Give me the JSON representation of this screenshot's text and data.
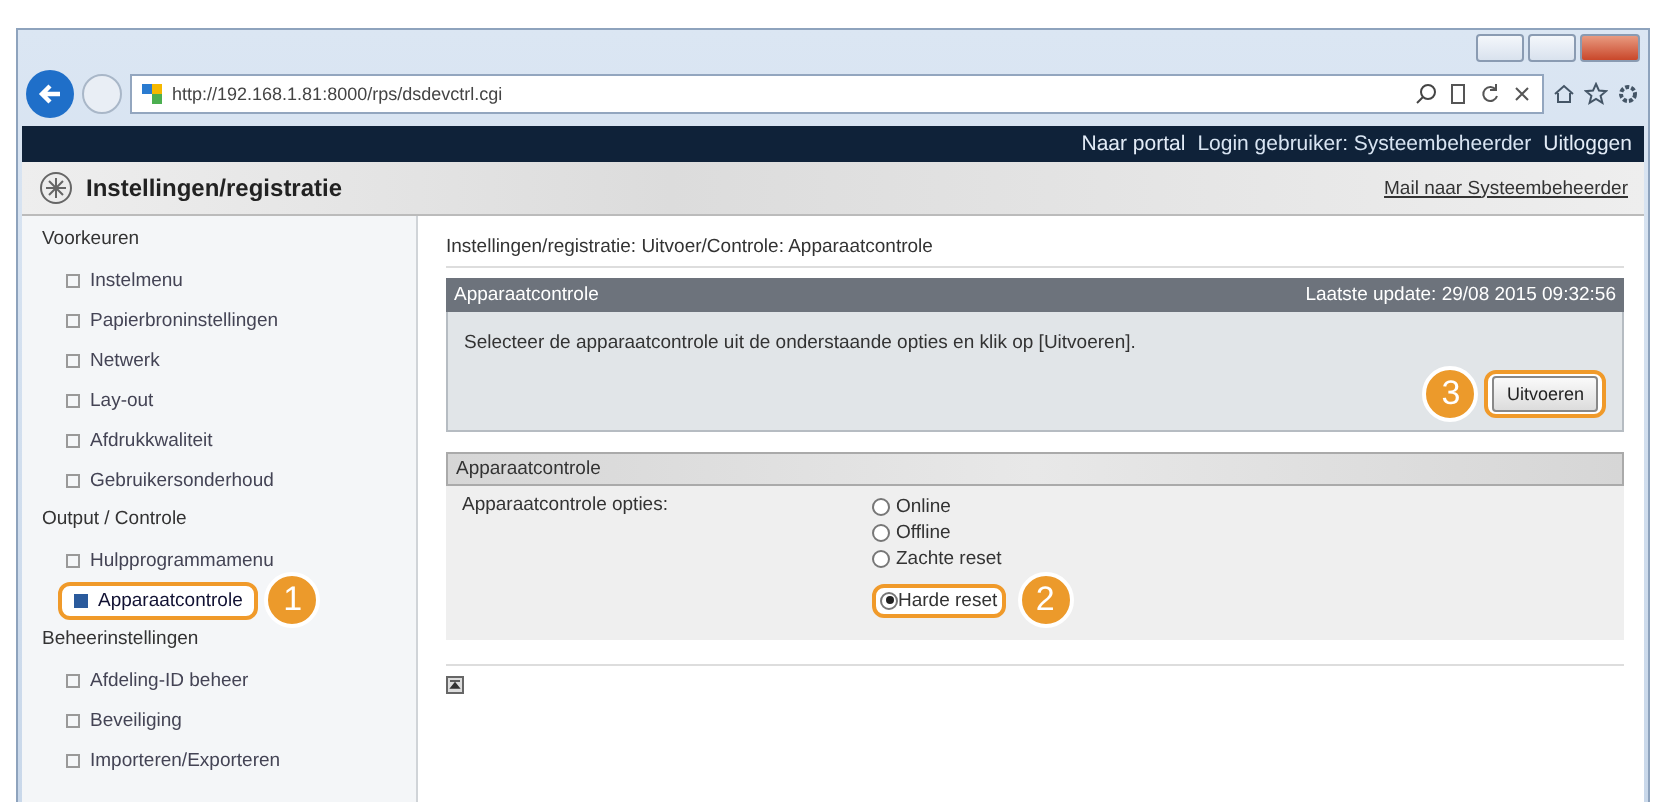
{
  "browser": {
    "url": "http://192.168.1.81:8000/rps/dsdevctrl.cgi"
  },
  "top_bar": [
    {
      "kind": "link",
      "text": "Naar portal"
    },
    {
      "kind": "text",
      "text": "Login gebruiker: Systeembeheerder"
    },
    {
      "kind": "link",
      "text": "Uitloggen"
    }
  ],
  "header": {
    "title": "Instellingen/registratie",
    "mail_link": "Mail naar Systeembeheerder"
  },
  "sidebar": [
    {
      "title": "Voorkeuren",
      "items": [
        {
          "label": "Instelmenu",
          "selected": false
        },
        {
          "label": "Papierbroninstellingen",
          "selected": false
        },
        {
          "label": "Netwerk",
          "selected": false
        },
        {
          "label": "Lay-out",
          "selected": false
        },
        {
          "label": "Afdrukkwaliteit",
          "selected": false
        },
        {
          "label": "Gebruikersonderhoud",
          "selected": false
        }
      ]
    },
    {
      "title": "Output / Controle",
      "items": [
        {
          "label": "Hulpprogrammamenu",
          "selected": false
        },
        {
          "label": "Apparaatcontrole",
          "selected": true,
          "callout": "1"
        }
      ]
    },
    {
      "title": "Beheerinstellingen",
      "items": [
        {
          "label": "Afdeling-ID beheer",
          "selected": false
        },
        {
          "label": "Beveiliging",
          "selected": false
        },
        {
          "label": "Importeren/Exporteren",
          "selected": false
        }
      ]
    }
  ],
  "breadcrumb": "Instellingen/registratie: Uitvoer/Controle: Apparaatcontrole",
  "panel": {
    "title": "Apparaatcontrole",
    "last_update": "Laatste update: 29/08 2015 09:32:56",
    "instruction": "Selecteer de apparaatcontrole uit de onderstaande opties en klik op [Uitvoeren].",
    "button": {
      "label": "Uitvoeren",
      "callout": "3"
    }
  },
  "options_panel": {
    "title": "Apparaatcontrole",
    "field_label": "Apparaatcontrole opties:",
    "options": [
      {
        "label": "Online",
        "selected": false
      },
      {
        "label": "Offline",
        "selected": false
      },
      {
        "label": "Zachte reset",
        "selected": false
      },
      {
        "label": "Harde reset",
        "selected": true,
        "callout": "2"
      }
    ]
  }
}
